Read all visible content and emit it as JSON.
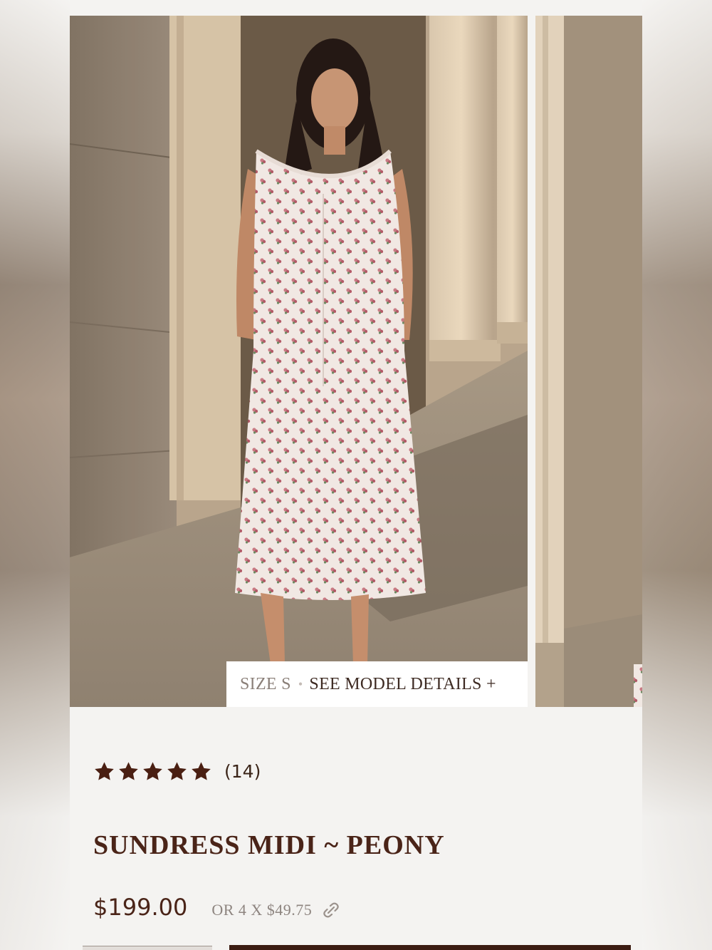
{
  "gallery": {
    "main_image_alt": "Model wearing floral print sleeveless midi sundress",
    "next_image_alt": "Next product image preview",
    "model_tag": {
      "size": "SIZE S",
      "separator": "•",
      "details_link": "SEE MODEL DETAILS +"
    }
  },
  "product": {
    "rating_value": 5,
    "rating_count": "(14)",
    "title": "SUNDRESS MIDI ~ PEONY",
    "price": "$199.00",
    "installments": "OR 4 X $49.75"
  },
  "colors": {
    "accent_brown": "#4a2418",
    "star": "#4a1f12",
    "muted_text": "#8e8580",
    "background": "#f4f3f1"
  },
  "icons": {
    "star": "star-icon",
    "installment": "link-chain-icon"
  }
}
